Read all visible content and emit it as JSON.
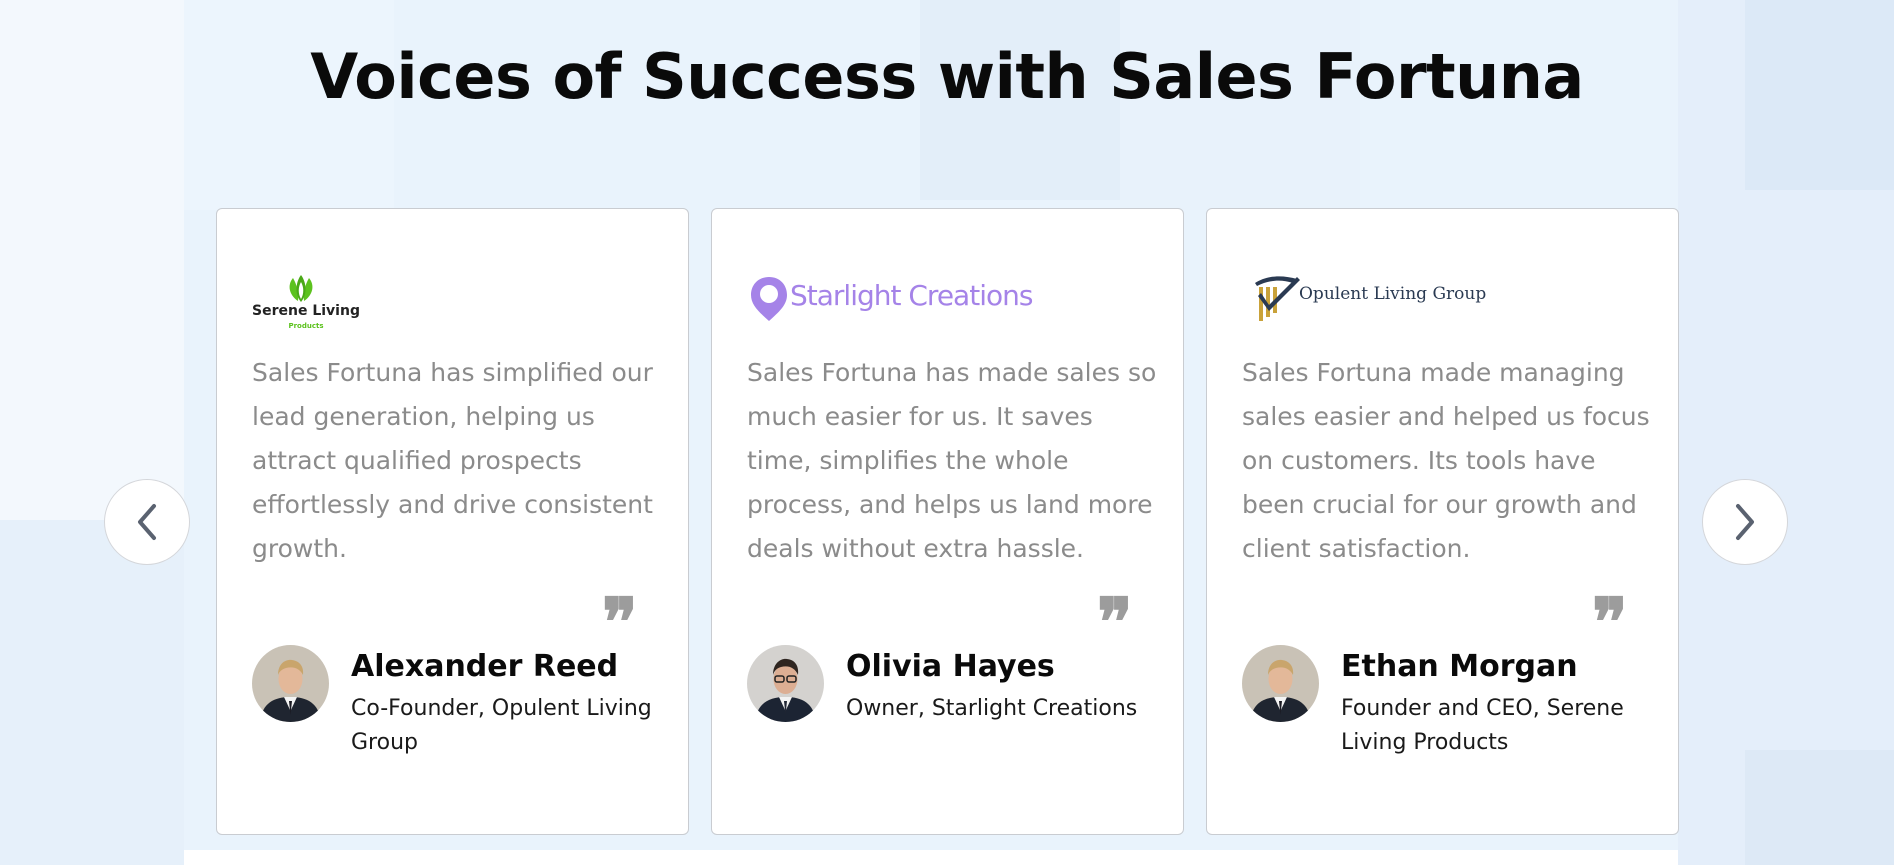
{
  "section": {
    "title": "Voices of Success with Sales Fortuna"
  },
  "colors": {
    "background": "#eef5fc",
    "heading": "#0a0a0a",
    "quote_text": "#8b8b8b",
    "quote_mark": "#9c9c9c",
    "card_border": "#c9ccd1",
    "serene_green": "#5cc21e",
    "starlight_purple": "#a583e8",
    "opulent_navy": "#2a3a52",
    "opulent_gold": "#c9a23a"
  },
  "carousel": {
    "prev_icon": "chevron-left-icon",
    "next_icon": "chevron-right-icon"
  },
  "testimonials": [
    {
      "logo": {
        "icon": "lotus-leaf-icon",
        "name": "Serene Living",
        "tagline": "Products"
      },
      "quote": "Sales Fortuna has simplified our lead generation, helping us attract qualified prospects effortlessly and drive consistent growth.",
      "quote_mark": "❞",
      "person": {
        "name": "Alexander Reed",
        "role": "Co-Founder, Opulent Living Group"
      }
    },
    {
      "logo": {
        "icon": "location-pin-icon",
        "name": "Starlight Creations"
      },
      "quote": "Sales Fortuna has made sales so much easier for us. It saves time, simplifies the whole process, and helps us land more deals without extra hassle.",
      "quote_mark": "❞",
      "person": {
        "name": "Olivia Hayes",
        "role": "Owner, Starlight Creations"
      }
    },
    {
      "logo": {
        "icon": "checkmark-columns-icon",
        "name": "Opulent Living Group"
      },
      "quote": "Sales Fortuna made managing sales easier and helped us focus on customers. Its tools have been crucial for our growth and client satisfaction.",
      "quote_mark": "❞",
      "person": {
        "name": "Ethan Morgan",
        "role": "Founder and CEO, Serene Living Products"
      }
    }
  ]
}
